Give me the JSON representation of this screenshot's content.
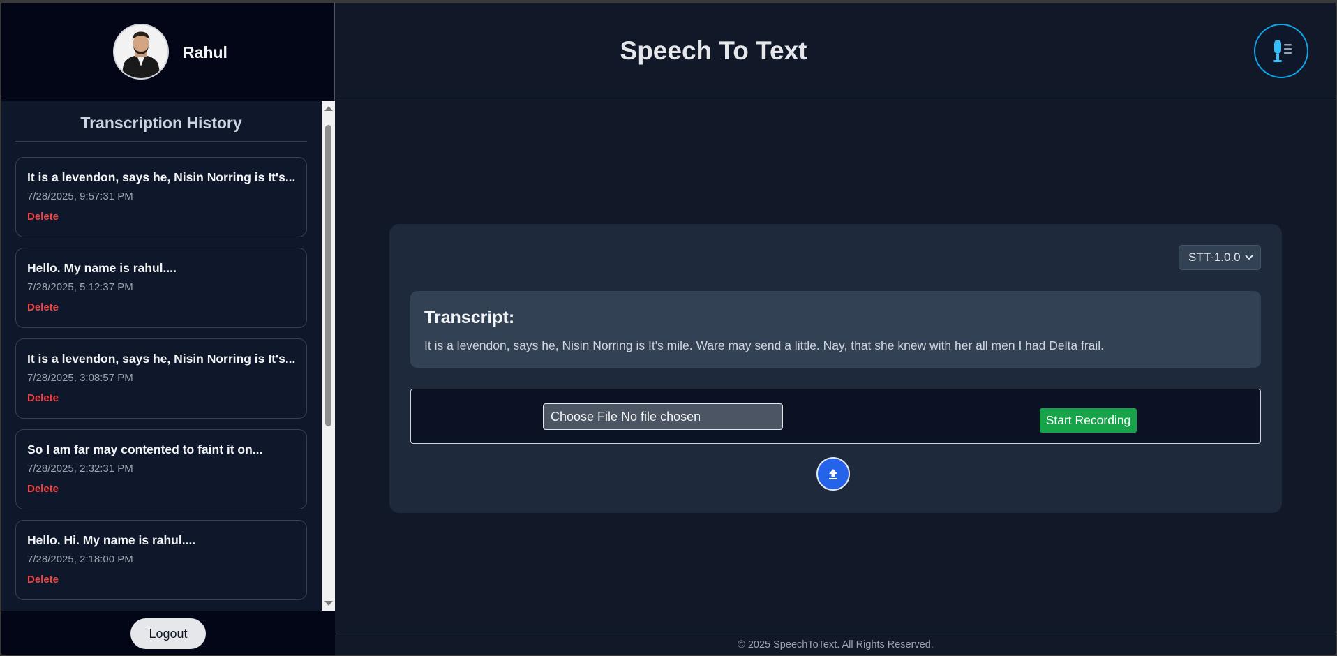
{
  "user": {
    "name": "Rahul"
  },
  "sidebar": {
    "history_title": "Transcription History",
    "items": [
      {
        "text": "It is a levendon, says he, Nisin Norring is It's...",
        "date": "7/28/2025, 9:57:31 PM",
        "delete_label": "Delete"
      },
      {
        "text": "Hello. My name is rahul....",
        "date": "7/28/2025, 5:12:37 PM",
        "delete_label": "Delete"
      },
      {
        "text": "It is a levendon, says he, Nisin Norring is It's...",
        "date": "7/28/2025, 3:08:57 PM",
        "delete_label": "Delete"
      },
      {
        "text": "So I am far may contented to faint it on...",
        "date": "7/28/2025, 2:32:31 PM",
        "delete_label": "Delete"
      },
      {
        "text": "Hello. Hi. My name is rahul....",
        "date": "7/28/2025, 2:18:00 PM",
        "delete_label": "Delete"
      }
    ],
    "logout_label": "Logout"
  },
  "header": {
    "title": "Speech To Text",
    "menu_icon": "microphone-menu-icon"
  },
  "main": {
    "model_select": {
      "value": "STT-1.0.0"
    },
    "transcript": {
      "title": "Transcript:",
      "text": "It is a levendon, says he, Nisin Norring is It's mile. Ware may send a little. Nay, that she knew with her all men I had Delta frail."
    },
    "file_input": {
      "label": "Choose File No file chosen"
    },
    "record_label": "Start Recording",
    "upload_icon": "upload-icon"
  },
  "footer": {
    "text": "© 2025 SpeechToText. All Rights Reserved."
  },
  "colors": {
    "accent": "#0ea5e9",
    "record": "#16a34a",
    "upload": "#2563eb",
    "delete": "#ef4444"
  }
}
